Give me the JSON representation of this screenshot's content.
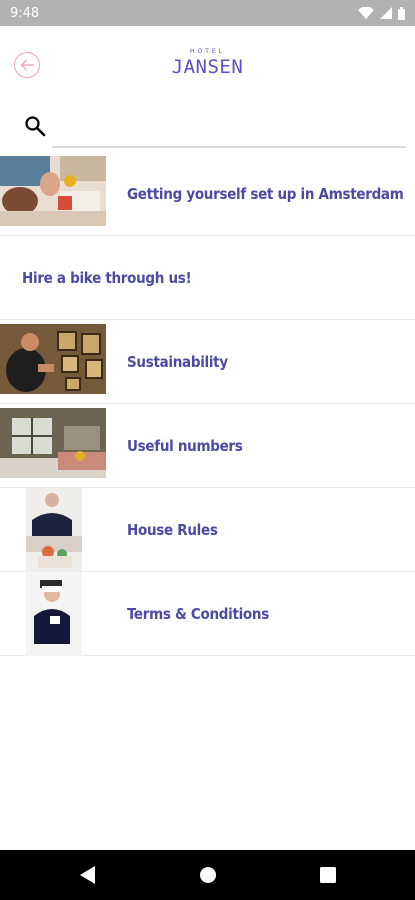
{
  "status_bar": {
    "time": "9:48"
  },
  "header": {
    "logo_sub": "HOTEL",
    "logo_main": "JANSEN"
  },
  "search": {
    "placeholder": "",
    "value": ""
  },
  "items": [
    {
      "label": "Getting yourself set up in Amsterdam"
    },
    {
      "label": "Hire a bike through us!"
    },
    {
      "label": "Sustainability"
    },
    {
      "label": "Useful numbers"
    },
    {
      "label": "House Rules"
    },
    {
      "label": "Terms & Conditions"
    }
  ],
  "colors": {
    "accent": "#5b4fc4",
    "label": "#4d4aa3",
    "back_ring": "#f4a6b6",
    "status_bar": "#b2b2b2",
    "nav_bar": "#000000"
  },
  "icons": {
    "back": "arrow-left-circle-icon",
    "search": "search-icon",
    "nav_back": "triangle-back-icon",
    "nav_home": "circle-home-icon",
    "nav_recents": "square-recents-icon"
  }
}
